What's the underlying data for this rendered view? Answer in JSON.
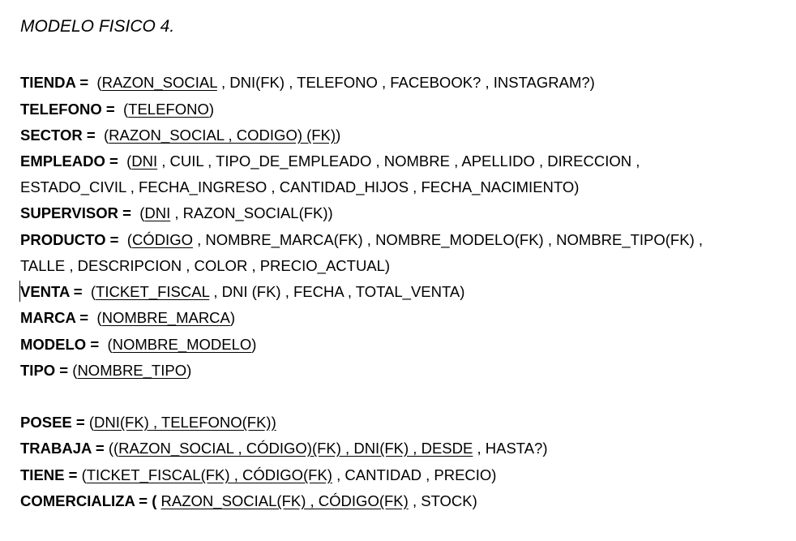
{
  "title": "MODELO FISICO 4.",
  "lines": [
    {
      "label": "TIENDA",
      "sep": " =  ",
      "parts": [
        [
          "(",
          0
        ],
        [
          "RAZON_SOCIAL",
          1
        ],
        [
          " , DNI(FK) , TELEFONO , FACEBOOK? , INSTAGRAM?)",
          0
        ]
      ]
    },
    {
      "label": "TELEFONO",
      "sep": " =  ",
      "parts": [
        [
          "(",
          0
        ],
        [
          "TELEFONO",
          1
        ],
        [
          ")",
          0
        ]
      ]
    },
    {
      "label": "SECTOR",
      "sep": " =  ",
      "parts": [
        [
          "(",
          0
        ],
        [
          "RAZON_SOCIAL , CODIGO) (FK)",
          1
        ],
        [
          ")",
          0
        ]
      ]
    },
    {
      "label": "EMPLEADO",
      "sep": " =  ",
      "parts": [
        [
          "(",
          0
        ],
        [
          "DNI",
          1
        ],
        [
          " , CUIL , TIPO_DE_EMPLEADO , NOMBRE , APELLIDO , DIRECCION ,",
          0
        ]
      ]
    },
    {
      "label": "",
      "sep": "",
      "parts": [
        [
          "ESTADO_CIVIL , FECHA_INGRESO , CANTIDAD_HIJOS , FECHA_NACIMIENTO)",
          0
        ]
      ]
    },
    {
      "label": "SUPERVISOR",
      "sep": " =  ",
      "parts": [
        [
          "(",
          0
        ],
        [
          "DNI",
          1
        ],
        [
          " , RAZON_SOCIAL(FK))",
          0
        ]
      ]
    },
    {
      "label": "PRODUCTO",
      "sep": " =  ",
      "parts": [
        [
          "(",
          0
        ],
        [
          "CÓDIGO",
          1
        ],
        [
          " , NOMBRE_MARCA(FK) , NOMBRE_MODELO(FK) , NOMBRE_TIPO(FK) ,",
          0
        ]
      ]
    },
    {
      "label": "",
      "sep": "",
      "parts": [
        [
          "TALLE , DESCRIPCION , COLOR , PRECIO_ACTUAL)",
          0
        ]
      ]
    },
    {
      "label": "VENTA",
      "sep": " =  ",
      "parts": [
        [
          "(",
          0
        ],
        [
          "TICKET_FISCAL",
          1
        ],
        [
          " , DNI (FK) , FECHA , TOTAL_VENTA)",
          0
        ]
      ]
    },
    {
      "label": "MARCA",
      "sep": " =  ",
      "parts": [
        [
          "(",
          0
        ],
        [
          "NOMBRE_MARCA",
          1
        ],
        [
          ")",
          0
        ]
      ]
    },
    {
      "label": "MODELO",
      "sep": " =  ",
      "parts": [
        [
          "(",
          0
        ],
        [
          "NOMBRE_MODELO",
          1
        ],
        [
          ")",
          0
        ]
      ]
    },
    {
      "label": "TIPO",
      "sep": " = ",
      "parts": [
        [
          "(",
          0
        ],
        [
          "NOMBRE_TIPO",
          1
        ],
        [
          ")",
          0
        ]
      ]
    },
    {
      "label": "POSEE",
      "sep": " = ",
      "parts": [
        [
          "(",
          0
        ],
        [
          "DNI(FK) , TELEFONO(FK))",
          1
        ]
      ]
    },
    {
      "label": "TRABAJA",
      "sep": " = ",
      "parts": [
        [
          "((",
          0
        ],
        [
          "RAZON_SOCIAL , CÓDIGO)(FK) , DNI(FK) , DESDE",
          1
        ],
        [
          " , HASTA?)",
          0
        ]
      ]
    },
    {
      "label": "TIENE",
      "sep": " = ",
      "parts": [
        [
          "(",
          0
        ],
        [
          "TICKET_FISCAL(FK) , CÓDIGO(FK)",
          1
        ],
        [
          " , CANTIDAD , PRECIO)",
          0
        ]
      ]
    },
    {
      "label": "COMERCIALIZA",
      "sep": " = ( ",
      "parts": [
        [
          "RAZON_SOCIAL(FK) , CÓDIGO(FK)",
          1
        ],
        [
          " , STOCK)",
          0
        ]
      ]
    }
  ]
}
